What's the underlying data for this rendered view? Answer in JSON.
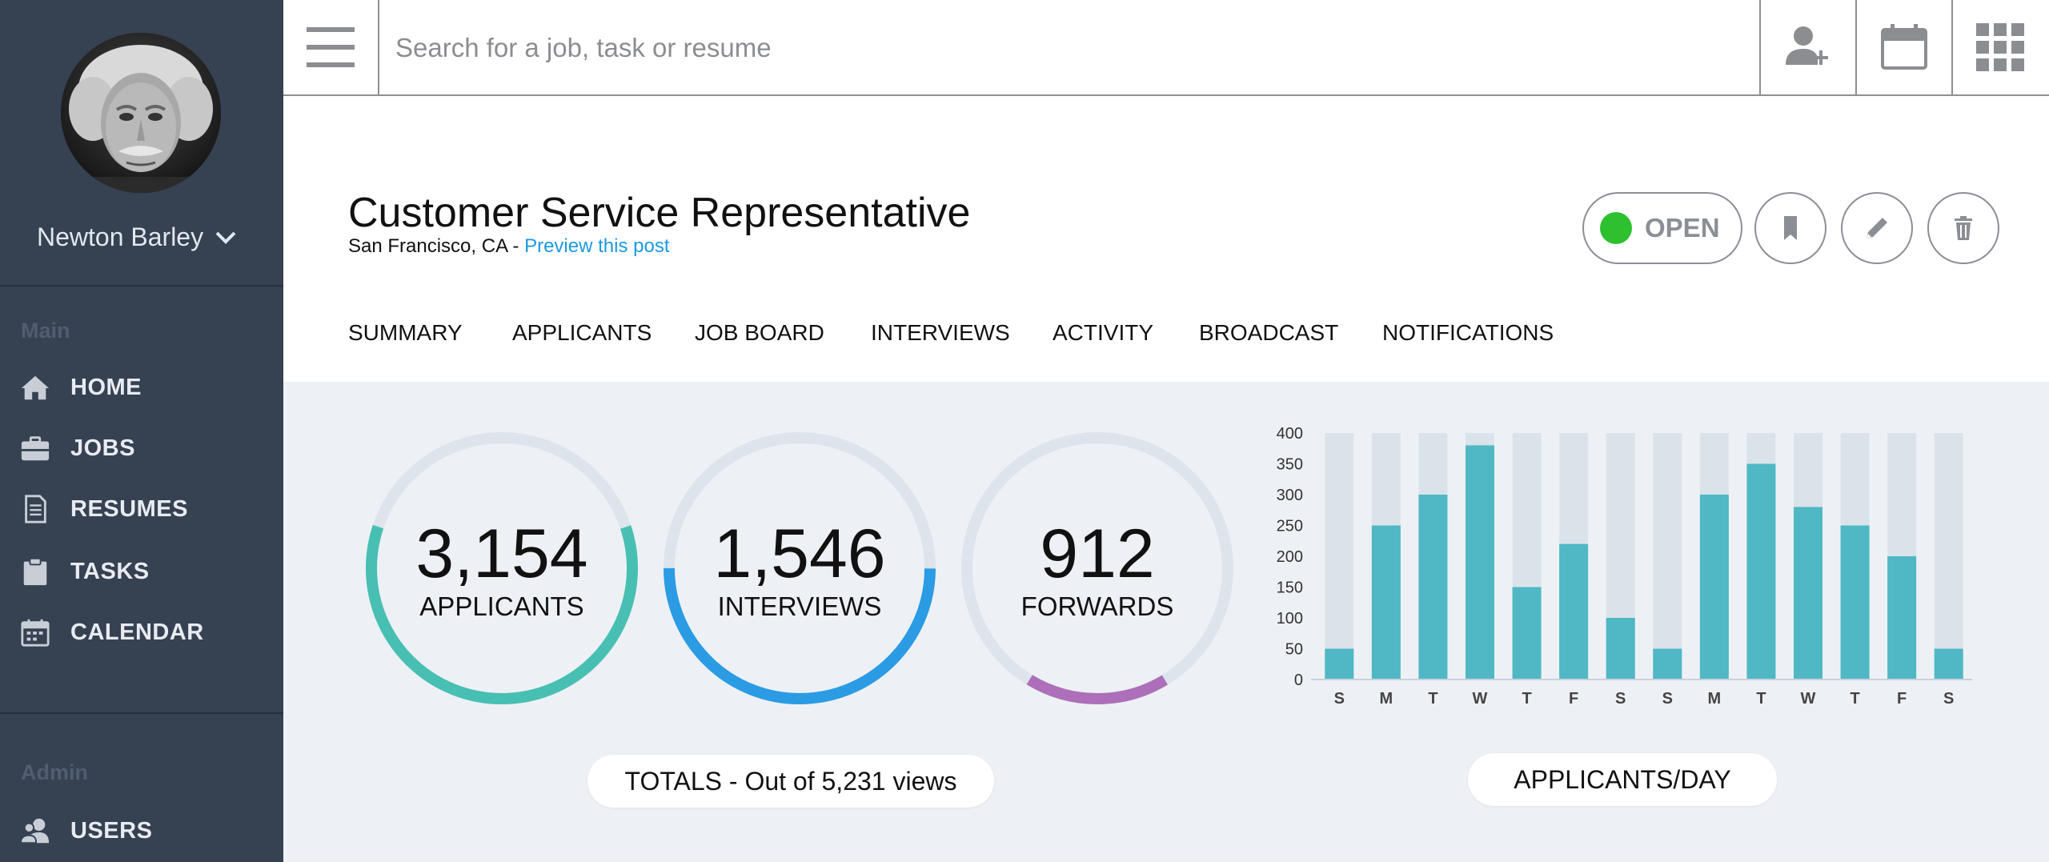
{
  "user": {
    "name": "Newton Barley"
  },
  "sidebar": {
    "sections": [
      {
        "label": "Main",
        "items": [
          {
            "label": "HOME",
            "icon": "home-icon"
          },
          {
            "label": "JOBS",
            "icon": "briefcase-icon"
          },
          {
            "label": "RESUMES",
            "icon": "document-icon"
          },
          {
            "label": "TASKS",
            "icon": "clipboard-icon"
          },
          {
            "label": "CALENDAR",
            "icon": "calendar-icon"
          }
        ]
      },
      {
        "label": "Admin",
        "items": [
          {
            "label": "USERS",
            "icon": "users-icon"
          }
        ]
      }
    ]
  },
  "topbar": {
    "search_placeholder": "Search for a job, task or resume",
    "actions": [
      "add-user-icon",
      "calendar-icon",
      "apps-grid-icon"
    ]
  },
  "job": {
    "title": "Customer Service Representative",
    "location": "San Francisco, CA - ",
    "preview_link": "Preview this post",
    "status": "OPEN",
    "status_color": "#2ec02e"
  },
  "tabs": [
    "SUMMARY",
    "APPLICANTS",
    "JOB BOARD",
    "INTERVIEWS",
    "ACTIVITY",
    "BROADCAST",
    "NOTIFICATIONS"
  ],
  "stats": [
    {
      "value": "3,154",
      "label": "APPLICANTS",
      "color": "#48bfb3",
      "progress": 0.603
    },
    {
      "value": "1,546",
      "label": "INTERVIEWS",
      "color": "#2b9be4",
      "progress": 0.5
    },
    {
      "value": "912",
      "label": "FORWARDS",
      "color": "#ad6fb9",
      "progress": 0.174
    }
  ],
  "totals_label": "TOTALS - Out of 5,231 views",
  "chart_label": "APPLICANTS/DAY",
  "colors": {
    "sidebar": "#364152",
    "content_bg": "#edf1f5",
    "bar": "#4fb8c4",
    "bar_track": "#dbe3ea"
  },
  "chart_data": {
    "type": "bar",
    "categories": [
      "S",
      "M",
      "T",
      "W",
      "T",
      "F",
      "S",
      "S",
      "M",
      "T",
      "W",
      "T",
      "F",
      "S"
    ],
    "values": [
      50,
      250,
      300,
      380,
      150,
      220,
      100,
      50,
      300,
      350,
      280,
      250,
      200,
      50
    ],
    "ylim": [
      0,
      400
    ],
    "yticks": [
      0,
      50,
      100,
      150,
      200,
      250,
      300,
      350,
      400
    ],
    "title": "",
    "xlabel": "",
    "ylabel": ""
  }
}
